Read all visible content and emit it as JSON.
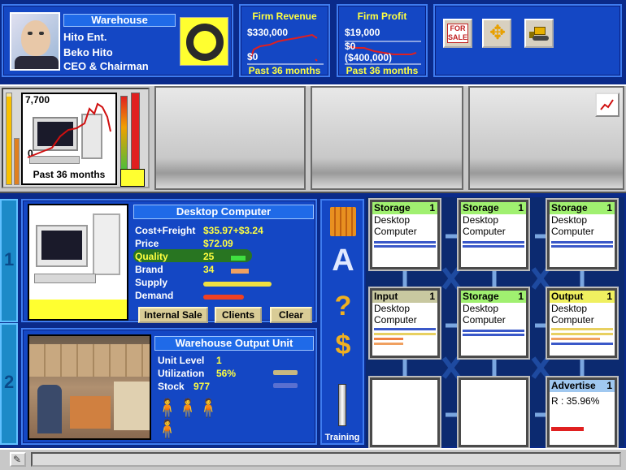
{
  "header": {
    "firm_type": "Warehouse",
    "company": "Hito Ent.",
    "person": "Beko Hito",
    "role": "CEO & Chairman"
  },
  "revenue": {
    "title": "Firm Revenue",
    "top": "$330,000",
    "bottom": "$0",
    "period": "Past 36 months"
  },
  "profit": {
    "title": "Firm Profit",
    "top": "$19,000",
    "mid": "$0",
    "bottom": "($400,000)",
    "period": "Past 36 months"
  },
  "toolbar": {
    "sale_line1": "FOR",
    "sale_line2": "SALE"
  },
  "product_strip": {
    "max": "7,700",
    "min": "0",
    "period": "Past 36 months"
  },
  "product": {
    "title": "Desktop Computer",
    "labels": [
      "Cost+Freight",
      "Price",
      "Quality",
      "Brand",
      "Supply",
      "Demand"
    ],
    "values": [
      "$35.97+$3.24",
      "$72.09",
      "25",
      "34",
      "",
      ""
    ],
    "quality_bar": 0.35,
    "brand_bar": 0.3,
    "supply_bar": 1.0,
    "demand_bar": 0.6
  },
  "buttons": {
    "internal_sale": "Internal Sale",
    "clients": "Clients",
    "clear": "Clear"
  },
  "unit_panel": {
    "title": "Warehouse Output Unit",
    "level_label": "Unit Level",
    "level_value": "1",
    "util_label": "Utilization",
    "util_value": "56%",
    "stock_label": "Stock",
    "stock_value": "977"
  },
  "side_icons": {
    "training": "Training"
  },
  "side_tabs": {
    "tab1": "1",
    "tab2": "2"
  },
  "units": [
    {
      "type": "Storage",
      "level": "1",
      "line1": "Desktop",
      "line2": "Computer",
      "color": "#a0f070"
    },
    {
      "type": "Storage",
      "level": "1",
      "line1": "Desktop",
      "line2": "Computer",
      "color": "#a0f070"
    },
    {
      "type": "Storage",
      "level": "1",
      "line1": "Desktop",
      "line2": "Computer",
      "color": "#a0f070"
    },
    {
      "type": "Input",
      "level": "1",
      "line1": "Desktop",
      "line2": "Computer",
      "color": "#c8c8a0"
    },
    {
      "type": "Storage",
      "level": "1",
      "line1": "Desktop",
      "line2": "Computer",
      "color": "#a0f070"
    },
    {
      "type": "Output",
      "level": "1",
      "line1": "Desktop",
      "line2": "Computer",
      "color": "#f0f060"
    },
    {
      "type": "Advertise",
      "level": "1",
      "line1": "R : 35.96%",
      "line2": "",
      "color": "#a0c8f0"
    }
  ]
}
